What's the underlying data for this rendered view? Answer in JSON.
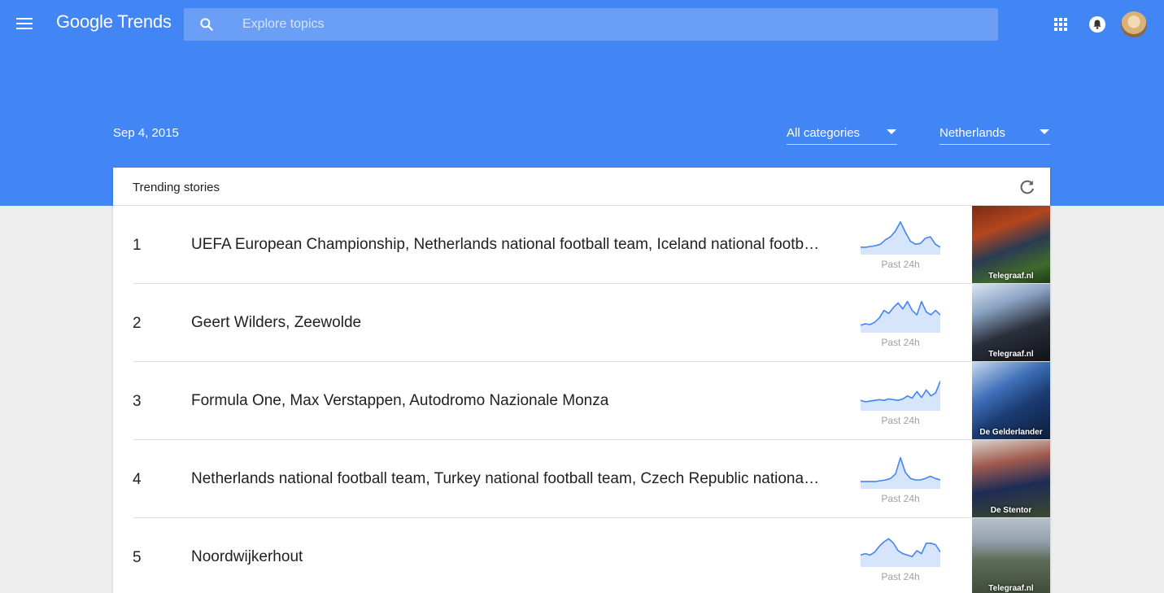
{
  "app": {
    "logo_text": "Google Trends",
    "search_placeholder": "Explore topics"
  },
  "filters": {
    "date": "Sep 4, 2015",
    "category": "All categories",
    "geo": "Netherlands"
  },
  "card": {
    "title": "Trending stories",
    "stories": [
      {
        "rank": "1",
        "title": "UEFA European Championship, Netherlands national football team, Iceland national football team",
        "sparkline_label": "Past 24h",
        "sparkline": [
          10,
          10,
          11,
          12,
          14,
          20,
          24,
          32,
          44,
          30,
          18,
          14,
          15,
          22,
          24,
          14,
          10
        ],
        "image_source": "Telegraaf.nl"
      },
      {
        "rank": "2",
        "title": "Geert Wilders, Zeewolde",
        "sparkline_label": "Past 24h",
        "sparkline": [
          10,
          12,
          11,
          14,
          20,
          30,
          26,
          34,
          40,
          32,
          42,
          30,
          24,
          42,
          28,
          24,
          30,
          24
        ],
        "image_source": "Telegraaf.nl"
      },
      {
        "rank": "3",
        "title": "Formula One, Max Verstappen, Autodromo Nazionale Monza",
        "sparkline_label": "Past 24h",
        "sparkline": [
          14,
          12,
          13,
          14,
          15,
          14,
          16,
          15,
          14,
          16,
          20,
          17,
          26,
          18,
          28,
          20,
          24,
          40
        ],
        "image_source": "De Gelderlander"
      },
      {
        "rank": "4",
        "title": "Netherlands national football team, Turkey national football team, Czech Republic national football team",
        "sparkline_label": "Past 24h",
        "sparkline": [
          10,
          10,
          10,
          10,
          11,
          12,
          14,
          20,
          42,
          22,
          14,
          12,
          12,
          14,
          17,
          14,
          12
        ],
        "image_source": "De Stentor"
      },
      {
        "rank": "5",
        "title": "Noordwijkerhout",
        "sparkline_label": "Past 24h",
        "sparkline": [
          16,
          18,
          16,
          20,
          28,
          34,
          38,
          32,
          22,
          18,
          16,
          14,
          22,
          18,
          32,
          32,
          30,
          20
        ],
        "image_source": "Telegraaf.nl"
      }
    ]
  },
  "colors": {
    "brand_blue": "#4285f4",
    "sparkline_line": "#4285f4",
    "sparkline_fill": "#d6e4fc"
  }
}
